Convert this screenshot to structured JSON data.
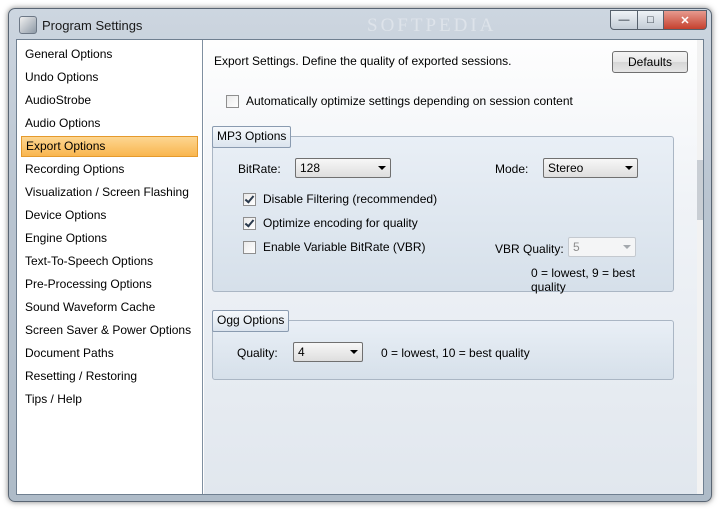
{
  "window": {
    "title": "Program Settings",
    "watermark": "SOFTPEDIA",
    "controls": {
      "minimize": "—",
      "maximize": "□",
      "close": "✕"
    }
  },
  "sidebar": {
    "items": [
      {
        "label": "General Options"
      },
      {
        "label": "Undo Options"
      },
      {
        "label": "AudioStrobe"
      },
      {
        "label": "Audio Options"
      },
      {
        "label": "Export Options",
        "selected": true
      },
      {
        "label": "Recording Options"
      },
      {
        "label": "Visualization / Screen Flashing"
      },
      {
        "label": "Device Options"
      },
      {
        "label": "Engine Options"
      },
      {
        "label": "Text-To-Speech Options"
      },
      {
        "label": "Pre-Processing Options"
      },
      {
        "label": "Sound Waveform Cache"
      },
      {
        "label": "Screen Saver & Power Options"
      },
      {
        "label": "Document Paths"
      },
      {
        "label": "Resetting / Restoring"
      },
      {
        "label": "Tips / Help"
      }
    ]
  },
  "main": {
    "intro": "Export Settings. Define the quality of exported sessions.",
    "defaults_label": "Defaults",
    "auto_optimize": {
      "label": "Automatically optimize settings depending on session content",
      "checked": false
    },
    "mp3": {
      "legend": "MP3 Options",
      "bitrate_label": "BitRate:",
      "bitrate_value": "128",
      "mode_label": "Mode:",
      "mode_value": "Stereo",
      "disable_filtering": {
        "label": "Disable Filtering (recommended)",
        "checked": true
      },
      "optimize_encoding": {
        "label": "Optimize encoding for quality",
        "checked": true
      },
      "vbr": {
        "label": "Enable Variable BitRate (VBR)",
        "checked": false
      },
      "vbr_quality_label": "VBR Quality:",
      "vbr_quality_value": "5",
      "vbr_note": "0 = lowest, 9 = best quality"
    },
    "ogg": {
      "legend": "Ogg Options",
      "quality_label": "Quality:",
      "quality_value": "4",
      "quality_note": "0 = lowest, 10 = best quality"
    }
  }
}
